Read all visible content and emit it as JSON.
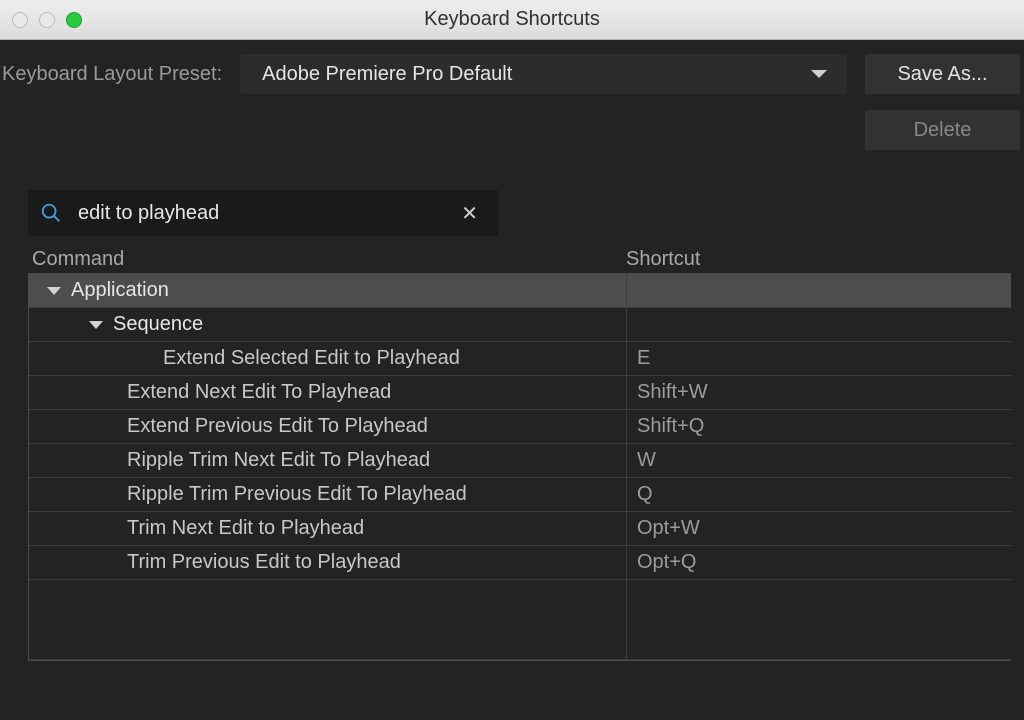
{
  "window": {
    "title": "Keyboard Shortcuts"
  },
  "toolbar": {
    "preset_label": "Keyboard Layout Preset:",
    "preset_value": "Adobe Premiere Pro Default",
    "save_as_label": "Save As...",
    "delete_label": "Delete"
  },
  "search": {
    "value": "edit to playhead"
  },
  "headers": {
    "command": "Command",
    "shortcut": "Shortcut"
  },
  "tree": {
    "group": "Application",
    "subgroup": "Sequence",
    "items": [
      {
        "label": "Extend Selected Edit to Playhead",
        "shortcut": "E",
        "deep": true
      },
      {
        "label": "Extend Next Edit To Playhead",
        "shortcut": "Shift+W",
        "deep": false
      },
      {
        "label": "Extend Previous Edit To Playhead",
        "shortcut": "Shift+Q",
        "deep": false
      },
      {
        "label": "Ripple Trim Next Edit To Playhead",
        "shortcut": "W",
        "deep": false
      },
      {
        "label": "Ripple Trim Previous Edit To Playhead",
        "shortcut": "Q",
        "deep": false
      },
      {
        "label": "Trim Next Edit to Playhead",
        "shortcut": "Opt+W",
        "deep": false
      },
      {
        "label": "Trim Previous Edit to Playhead",
        "shortcut": "Opt+Q",
        "deep": false
      }
    ]
  }
}
